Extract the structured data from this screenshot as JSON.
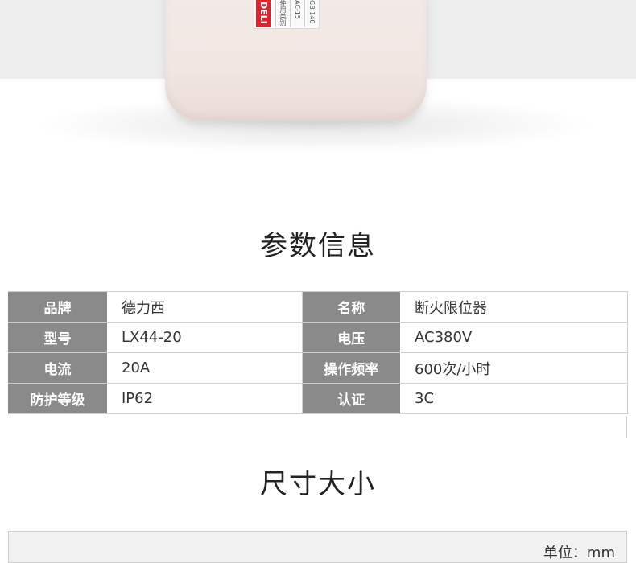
{
  "product_label": {
    "brand_logo": "DELI",
    "lines": [
      "使用类别",
      "AC-15",
      "GB 140"
    ]
  },
  "params_section": {
    "title": "参数信息",
    "rows": [
      {
        "k1": "品牌",
        "v1": "德力西",
        "k2": "名称",
        "v2": "断火限位器"
      },
      {
        "k1": "型号",
        "v1": "LX44-20",
        "k2": "电压",
        "v2": "AC380V"
      },
      {
        "k1": "电流",
        "v1": "20A",
        "k2": "操作频率",
        "v2": "600次/小时"
      },
      {
        "k1": "防护等级",
        "v1": "IP62",
        "k2": "认证",
        "v2": "3C"
      }
    ]
  },
  "dims_section": {
    "title": "尺寸大小",
    "unit": "单位：mm"
  },
  "colors": {
    "key_cell_bg": "#8a8a8a",
    "logo_red": "#d9262c",
    "product_body": "#f2e7e3"
  }
}
